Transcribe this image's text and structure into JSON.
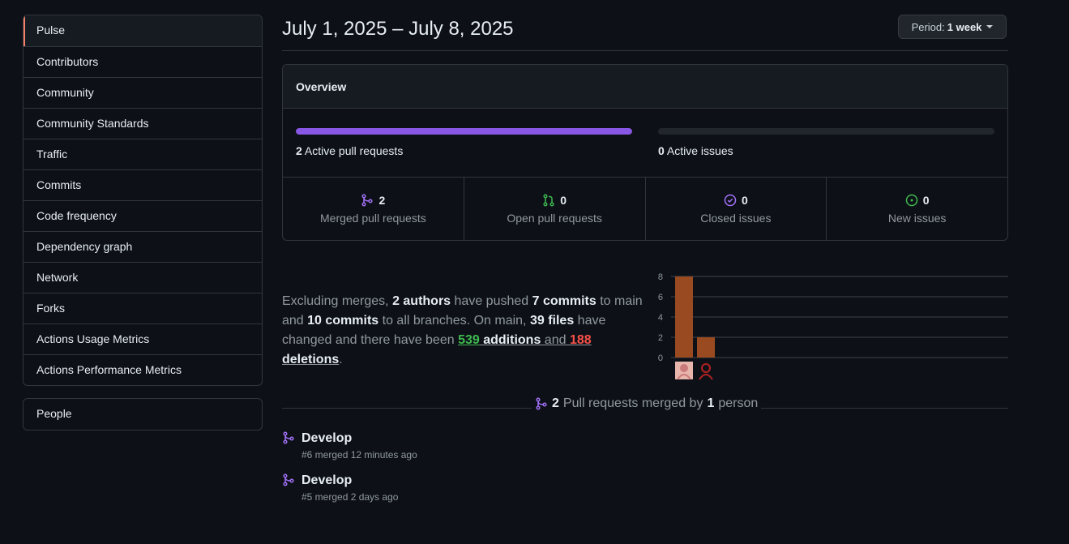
{
  "sidebar": {
    "items": [
      {
        "label": "Pulse"
      },
      {
        "label": "Contributors"
      },
      {
        "label": "Community"
      },
      {
        "label": "Community Standards"
      },
      {
        "label": "Traffic"
      },
      {
        "label": "Commits"
      },
      {
        "label": "Code frequency"
      },
      {
        "label": "Dependency graph"
      },
      {
        "label": "Network"
      },
      {
        "label": "Forks"
      },
      {
        "label": "Actions Usage Metrics"
      },
      {
        "label": "Actions Performance Metrics"
      }
    ],
    "people_label": "People"
  },
  "header": {
    "title": "July 1, 2025 – July 8, 2025",
    "period_prefix": "Period:",
    "period_value": "1 week"
  },
  "overview": {
    "title": "Overview",
    "active_prs_count": "2",
    "active_prs_label": "Active pull requests",
    "active_prs_fill": 1.0,
    "active_issues_count": "0",
    "active_issues_label": "Active issues",
    "active_issues_fill": 0.0,
    "stats": [
      {
        "value": "2",
        "label": "Merged pull requests",
        "icon": "merged-pr-icon",
        "color": "#a371f7"
      },
      {
        "value": "0",
        "label": "Open pull requests",
        "icon": "open-pr-icon",
        "color": "#3fb950"
      },
      {
        "value": "0",
        "label": "Closed issues",
        "icon": "issue-closed-icon",
        "color": "#a371f7"
      },
      {
        "value": "0",
        "label": "New issues",
        "icon": "issue-opened-icon",
        "color": "#3fb950"
      }
    ]
  },
  "summary": {
    "t1": "Excluding merges, ",
    "authors": "2 authors",
    "t2": " have pushed ",
    "commits_main": "7 commits",
    "t3": " to main and ",
    "commits_all": "10 commits",
    "t4": " to all branches. On main, ",
    "files": "39 files",
    "t5": " have changed and there have been ",
    "additions_num": "539",
    "additions_word": " additions",
    "t6": " and ",
    "deletions_num": "188",
    "deletions_word": " deletions",
    "t7": "."
  },
  "chart_data": {
    "type": "bar",
    "categories": [
      "author-1",
      "author-2"
    ],
    "values": [
      8,
      2
    ],
    "yticks": [
      0,
      2,
      4,
      6,
      8
    ],
    "ylim": [
      0,
      8
    ],
    "bar_color": "#9a4a20",
    "grid": true
  },
  "merged": {
    "count": "2",
    "mid": "Pull requests merged by",
    "persons": "1",
    "end": "person"
  },
  "pull_requests": [
    {
      "title": "Develop",
      "meta": "#6 merged 12 minutes ago"
    },
    {
      "title": "Develop",
      "meta": "#5 merged 2 days ago"
    }
  ]
}
